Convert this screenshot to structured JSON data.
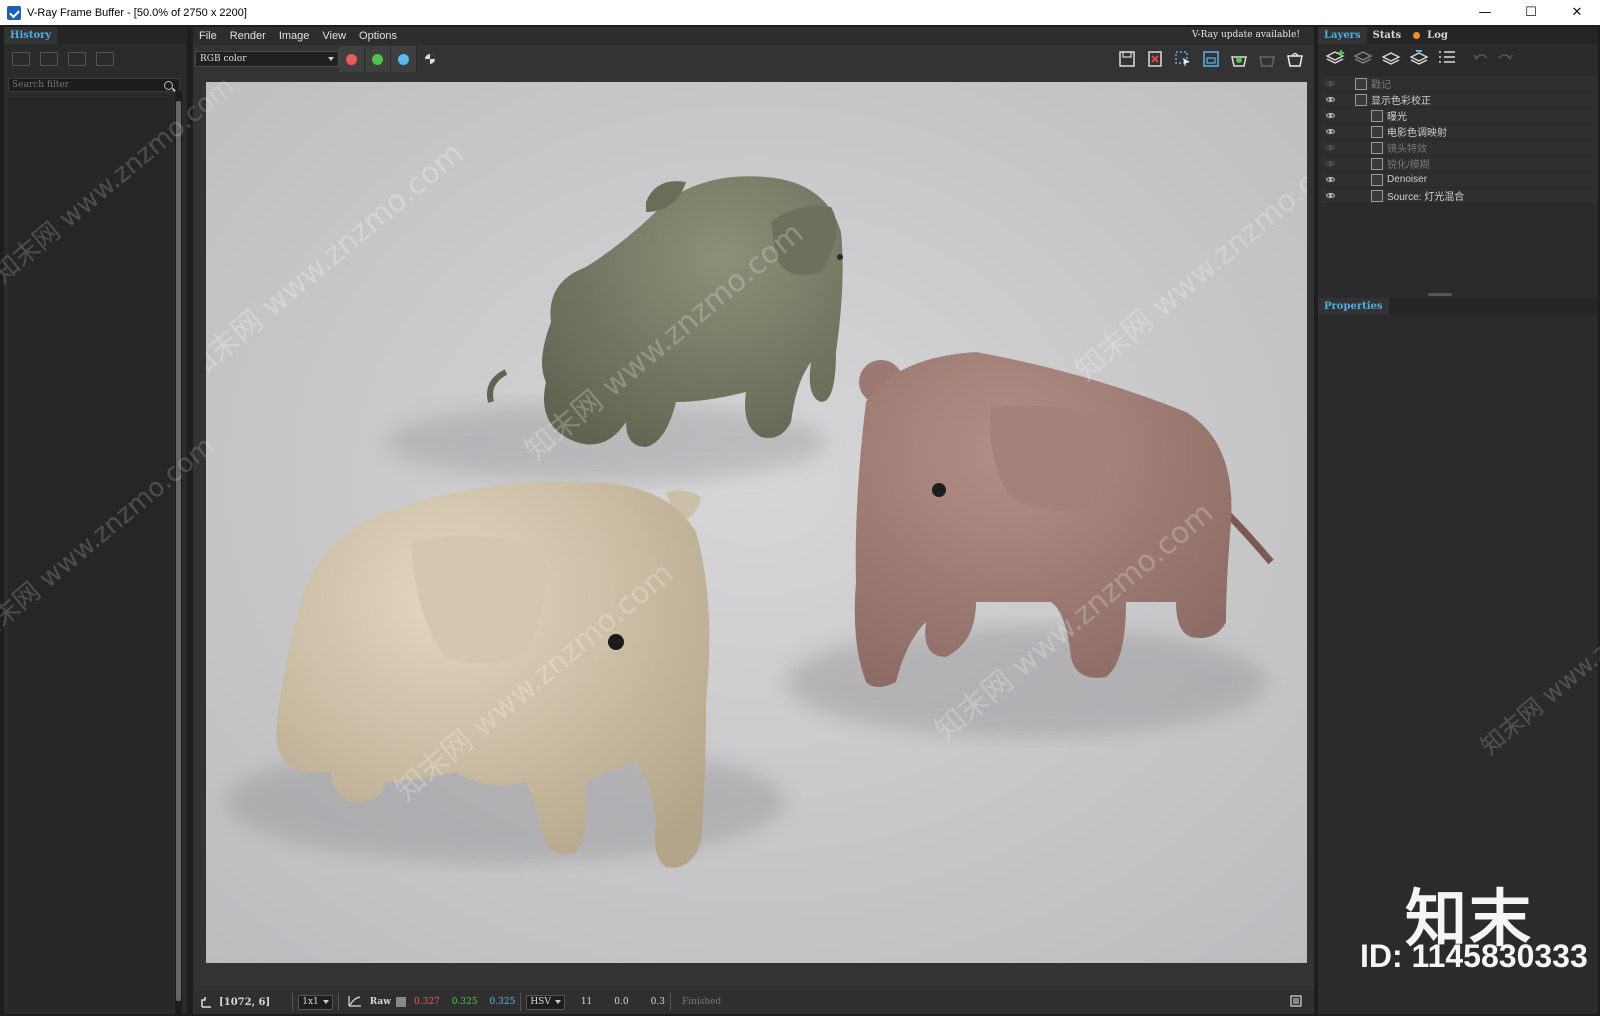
{
  "window": {
    "title": "V-Ray Frame Buffer - [50.0% of 2750 x 2200]",
    "controls": [
      "—",
      "☐",
      "✕"
    ]
  },
  "left_panel": {
    "tab": "History",
    "search_placeholder": "Search filter"
  },
  "menu": {
    "items": [
      "File",
      "Render",
      "Image",
      "View",
      "Options"
    ],
    "update_notice": "V-Ray update available!"
  },
  "toolbar": {
    "channel": "RGB color",
    "channel_colors": [
      "#e85b5b",
      "#4fc44f",
      "#5ab8ea"
    ]
  },
  "right_panel": {
    "tabs": [
      "Layers",
      "Stats",
      "Log"
    ],
    "layers": [
      {
        "label": "戳记",
        "enabled": false,
        "indent": 1
      },
      {
        "label": "显示色彩校正",
        "enabled": true,
        "indent": 1
      },
      {
        "label": "曝光",
        "enabled": true,
        "indent": 2
      },
      {
        "label": "电影色调映射",
        "enabled": true,
        "indent": 2
      },
      {
        "label": "镜头特效",
        "enabled": false,
        "indent": 2
      },
      {
        "label": "锐化/模糊",
        "enabled": false,
        "indent": 2
      },
      {
        "label": "Denoiser",
        "enabled": true,
        "indent": 2
      },
      {
        "label": "Source: 灯光混合",
        "enabled": true,
        "indent": 2
      }
    ],
    "properties_label": "Properties"
  },
  "status": {
    "coords": "[1072, 6]",
    "zoom": "1x1",
    "mode": "Raw",
    "r": "0.327",
    "g": "0.325",
    "b": "0.325",
    "color_space": "HSV",
    "h": "11",
    "s": "0.0",
    "v": "0.3",
    "state": "Finished"
  },
  "watermark": {
    "text": "知末网 www.znzmo.com",
    "brand": "知末",
    "id": "ID: 1145830333"
  }
}
